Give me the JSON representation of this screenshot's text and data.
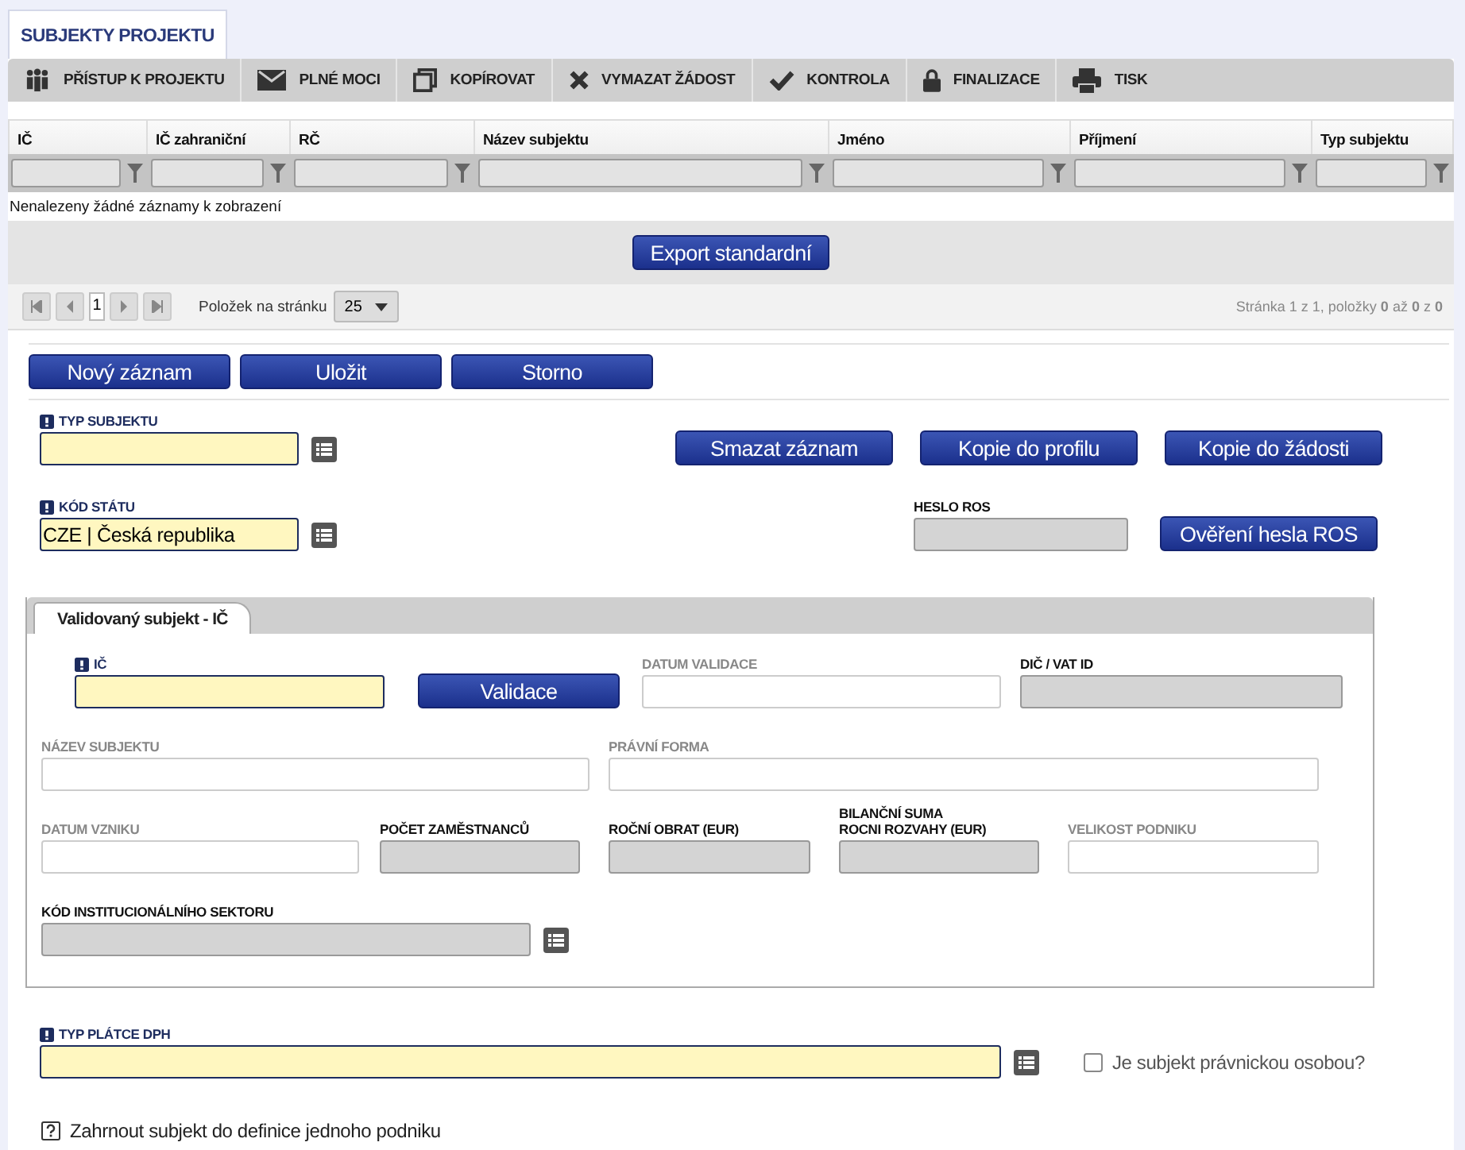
{
  "page_tab": {
    "label": "SUBJEKTY PROJEKTU",
    "selected": true
  },
  "toolbar": [
    "PŘÍSTUP K PROJEKTU",
    "PLNÉ MOCI",
    "KOPÍROVAT",
    "VYMAZAT ŽÁDOST",
    "KONTROLA",
    "FINALIZACE",
    "TISK"
  ],
  "grid": {
    "columns": [
      "IČ",
      "IČ zahraniční",
      "RČ",
      "Název subjektu",
      "Jméno",
      "Příjmení",
      "Typ subjektu"
    ],
    "empty_message": "Nenalezeny žádné záznamy k zobrazení",
    "export_button": "Export standardní",
    "pager": {
      "page": "1",
      "page_size_label": "Položek na stránku",
      "page_size": "25",
      "summary": "Stránka 1 z 1, položky **0** až **0** z **0**"
    }
  },
  "form_buttons": [
    "Nový záznam",
    "Uložit",
    "Storno"
  ],
  "record_buttons": [
    "Smazat záznam",
    "Kopie do profilu",
    "Kopie do žádosti"
  ],
  "typ_subjektu": {
    "label": "TYP SUBJEKTU",
    "required": true
  },
  "kod_statu": {
    "label": "KÓD STÁTU",
    "required": true,
    "value": "CZE | Česká republika"
  },
  "heslo_ros": {
    "label": "HESLO ROS",
    "button": "Ověření hesla ROS"
  },
  "validated_panel": {
    "tab": "Validovaný subjekt - IČ",
    "validate_button": "Validace",
    "fields": [
      {
        "label": [
          "IČ"
        ],
        "required": true,
        "disabled": false,
        "readonly": false
      },
      {
        "label": [
          "DATUM VALIDACE"
        ],
        "required": false,
        "disabled": true,
        "readonly": false
      },
      {
        "label": [
          "DIČ / VAT ID"
        ],
        "required": false,
        "disabled": false,
        "readonly": true
      },
      {
        "label": [
          "NÁZEV SUBJEKTU"
        ],
        "required": false,
        "disabled": true,
        "readonly": false
      },
      {
        "label": [
          "PRÁVNÍ FORMA"
        ],
        "required": false,
        "disabled": true,
        "readonly": false
      },
      {
        "label": [
          "DATUM VZNIKU"
        ],
        "required": false,
        "disabled": true,
        "readonly": false
      },
      {
        "label": [
          "POČET ZAMĚSTNANCŮ"
        ],
        "required": false,
        "disabled": false,
        "readonly": true
      },
      {
        "label": [
          "ROČNÍ OBRAT (EUR)"
        ],
        "required": false,
        "disabled": false,
        "readonly": true
      },
      {
        "label": [
          "BILANČNÍ SUMA",
          "ROCNI ROZVAHY (EUR)"
        ],
        "required": false,
        "disabled": false,
        "readonly": true
      },
      {
        "label": [
          "VELIKOST PODNIKU"
        ],
        "required": false,
        "disabled": true,
        "readonly": false
      },
      {
        "label": [
          "KÓD INSTITUCIONÁLNÍHO SEKTORU"
        ],
        "required": false,
        "disabled": false,
        "readonly": true
      }
    ]
  },
  "typ_platce": {
    "label": "TYP PLÁTCE DPH",
    "required": true
  },
  "pravnicka_osoba": {
    "label": "Je subjekt právnickou osobou?",
    "checked": false
  },
  "jeden_podnik": {
    "label": "Zahrnout subjekt do definice jednoho podniku",
    "indeterminate": true
  }
}
